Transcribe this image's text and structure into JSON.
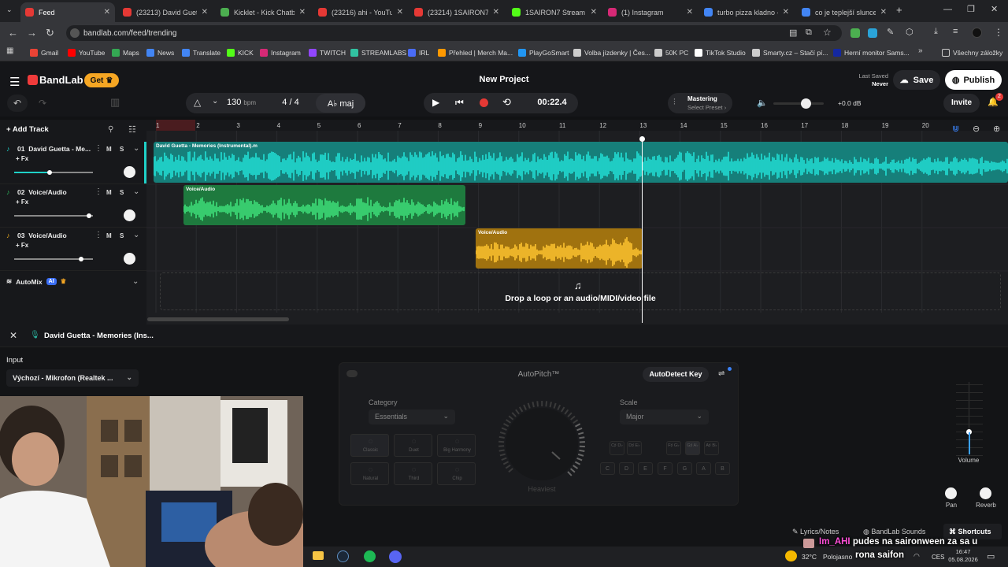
{
  "browser": {
    "tabs": [
      {
        "title": "Feed",
        "color": "#e53935",
        "active": true
      },
      {
        "title": "(23213) David Guetta",
        "color": "#e53935"
      },
      {
        "title": "Kicklet - Kick Chatbot",
        "color": "#4caf50"
      },
      {
        "title": "(23216) ahi - YouTube",
        "color": "#e53935"
      },
      {
        "title": "(23214) 1SAIRON7 -",
        "color": "#e53935"
      },
      {
        "title": "1SAIRON7 Stream -",
        "color": "#53fc18"
      },
      {
        "title": "(1) Instagram",
        "color": "#d62976"
      },
      {
        "title": "turbo pizza kladno -",
        "color": "#4285f4"
      },
      {
        "title": "co je teplejší slunce n",
        "color": "#4285f4"
      }
    ],
    "url": "bandlab.com/feed/trending",
    "bookmarks": [
      {
        "label": "Gmail",
        "color": "#ea4335"
      },
      {
        "label": "YouTube",
        "color": "#ff0000"
      },
      {
        "label": "Maps",
        "color": "#34a853"
      },
      {
        "label": "News",
        "color": "#4285f4"
      },
      {
        "label": "Translate",
        "color": "#4285f4"
      },
      {
        "label": "KICK",
        "color": "#53fc18"
      },
      {
        "label": "Instagram",
        "color": "#d62976"
      },
      {
        "label": "TWITCH",
        "color": "#9146ff"
      },
      {
        "label": "STREAMLABS",
        "color": "#31c3a2"
      },
      {
        "label": "IRL",
        "color": "#4a6cf7"
      },
      {
        "label": "Přehled | Merch Ma...",
        "color": "#ff9900"
      },
      {
        "label": "PlayGoSmart",
        "color": "#2196f3"
      },
      {
        "label": "Volba jízdenky | Čes...",
        "color": "#cccccc"
      },
      {
        "label": "50K PC",
        "color": "#cccccc"
      },
      {
        "label": "TikTok Studio",
        "color": "#ffffff"
      },
      {
        "label": "Smarty.cz – Stačí pí...",
        "color": "#cccccc"
      },
      {
        "label": "Herní monitor Sams...",
        "color": "#1428a0"
      }
    ],
    "all_bookmarks": "Všechny záložky"
  },
  "app": {
    "brand": "BandLab",
    "get_label": "Get",
    "project_title": "New Project",
    "last_saved_label": "Last Saved",
    "last_saved_value": "Never",
    "save_label": "Save",
    "publish_label": "Publish",
    "bpm_value": "130",
    "bpm_unit": "bpm",
    "time_sig": "4 / 4",
    "key": "A♭ maj",
    "time": "00:22.4",
    "mastering_label": "Mastering",
    "mastering_preset": "Select Preset",
    "volume_db": "+0.0 dB",
    "invite_label": "Invite",
    "notif_count": "2",
    "add_track_label": "Add Track",
    "automix_label": "AutoMix",
    "automix_badge": "AI",
    "drop_text": "Drop a loop or an audio/MIDI/video file"
  },
  "ruler": [
    "1",
    "2",
    "3",
    "4",
    "5",
    "6",
    "7",
    "8",
    "9",
    "10",
    "11",
    "12",
    "13",
    "14",
    "15",
    "16",
    "17",
    "18",
    "19",
    "20"
  ],
  "tracks": [
    {
      "num": "01",
      "name": "David Guetta - Me...",
      "fx": "+ Fx",
      "m": "M",
      "s": "S",
      "clip": "David Guetta - Memories (Instrumental).m",
      "color": "#1fd1c8",
      "volume": 0.45
    },
    {
      "num": "02",
      "name": "Voice/Audio",
      "fx": "+ Fx",
      "m": "M",
      "s": "S",
      "clip": "Voice/Audio",
      "color": "#2bb55a",
      "volume": 0.95
    },
    {
      "num": "03",
      "name": "Voice/Audio",
      "fx": "+ Fx",
      "m": "M",
      "s": "S",
      "clip": "Voice/Audio",
      "color": "#e8a81c",
      "volume": 0.85
    }
  ],
  "panel": {
    "track_title": "David Guetta - Memories (Ins...",
    "input_label": "Input",
    "input_value": "Výchozí - Mikrofon (Realtek ...",
    "effect_name": "AutoPitch™",
    "detect_label": "AutoDetect Key",
    "category_label": "Category",
    "category_value": "Essentials",
    "scale_label": "Scale",
    "scale_value": "Major",
    "styles": [
      "Classic",
      "Duet",
      "Big Harmony",
      "Natural",
      "Third",
      "Chip"
    ],
    "dial_label": "Heaviest",
    "keys_top": [
      "C♯ D♭",
      "D♯ E♭",
      "F♯ G♭",
      "G♯ A♭",
      "A♯ B♭"
    ],
    "keys_bottom": [
      "C",
      "D",
      "E",
      "F",
      "G",
      "A",
      "B"
    ],
    "volume_label": "Volume",
    "pan_label": "Pan",
    "reverb_label": "Reverb",
    "lyrics_label": "Lyrics/Notes",
    "sounds_label": "BandLab Sounds",
    "shortcuts_label": "Shortcuts"
  },
  "overlay": {
    "chat_user": "Im_AHI",
    "chat_message": "pudes na saironween za sa u",
    "chat_message2": "rona saifon"
  },
  "taskbar": {
    "weather_temp": "32°C",
    "weather_desc": "Polojasno",
    "lang": "CES",
    "time": "16:47",
    "date": "05.08.2026"
  }
}
